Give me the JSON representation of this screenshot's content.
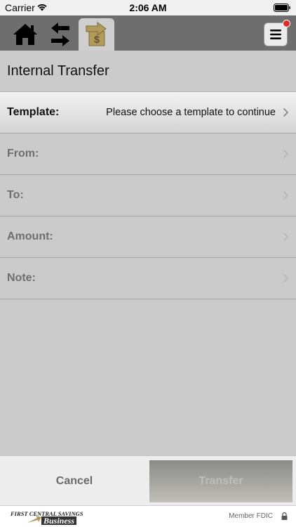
{
  "status_bar": {
    "carrier": "Carrier",
    "time": "2:06 AM"
  },
  "nav": {
    "icons": [
      "home-icon",
      "swap-arrows-icon",
      "transfer-money-icon",
      "hamburger-menu-icon"
    ],
    "active_tab": "transfer-money-icon"
  },
  "page": {
    "title": "Internal Transfer"
  },
  "form": {
    "template": {
      "label": "Template:",
      "value": "Please choose a template to continue"
    },
    "from": {
      "label": "From:"
    },
    "to": {
      "label": "To:"
    },
    "amount": {
      "label": "Amount:"
    },
    "note": {
      "label": "Note:"
    }
  },
  "actions": {
    "cancel_label": "Cancel",
    "transfer_label": "Transfer"
  },
  "footer": {
    "logo_top": "FIRST CENTRAL SAVINGS",
    "logo_bottom": "Business",
    "member_fdic": "Member FDIC"
  },
  "colors": {
    "nav_background": "#6e6e6e",
    "body_background": "#cbcbcb",
    "notification": "#e02a2a",
    "accent_gold": "#b49a5a"
  }
}
